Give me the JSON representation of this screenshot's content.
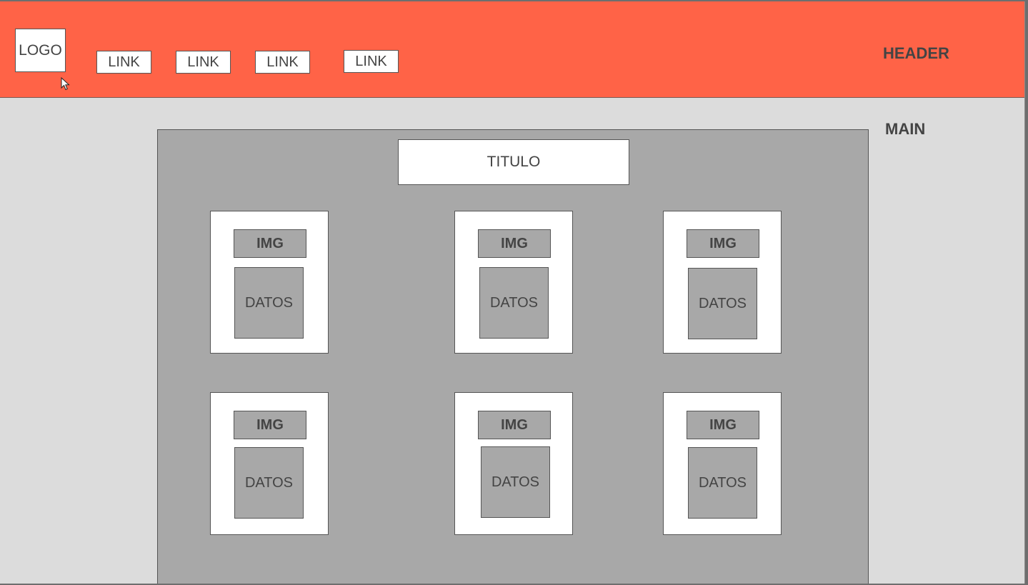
{
  "header": {
    "logo": "LOGO",
    "links": [
      "LINK",
      "LINK",
      "LINK",
      "LINK"
    ],
    "label": "HEADER",
    "color": "#ff6347"
  },
  "main": {
    "label": "MAIN",
    "title": "TITULO",
    "cards": [
      {
        "img": "IMG",
        "datos": "DATOS"
      },
      {
        "img": "IMG",
        "datos": "DATOS"
      },
      {
        "img": "IMG",
        "datos": "DATOS"
      },
      {
        "img": "IMG",
        "datos": "DATOS"
      },
      {
        "img": "IMG",
        "datos": "DATOS"
      },
      {
        "img": "IMG",
        "datos": "DATOS"
      }
    ]
  },
  "icons": {
    "cursor": "mouse-pointer-icon"
  }
}
